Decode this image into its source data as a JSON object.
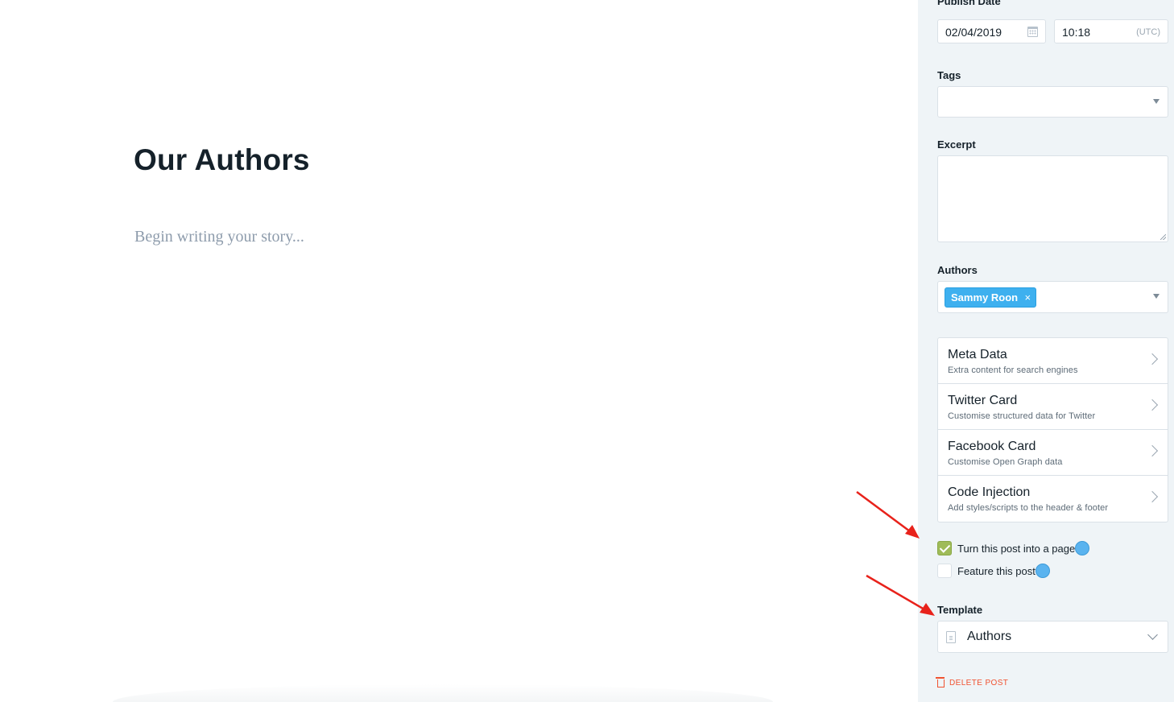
{
  "editor": {
    "title": "Our Authors",
    "story_placeholder": "Begin writing your story..."
  },
  "sidebar": {
    "publish_date_label": "Publish Date",
    "publish_date": "02/04/2019",
    "publish_time": "10:18",
    "timezone": "(UTC)",
    "tags_label": "Tags",
    "excerpt_label": "Excerpt",
    "authors_label": "Authors",
    "authors": [
      "Sammy Roon"
    ],
    "author_remove_glyph": "×",
    "menu": [
      {
        "title": "Meta Data",
        "description": "Extra content for search engines"
      },
      {
        "title": "Twitter Card",
        "description": "Customise structured data for Twitter"
      },
      {
        "title": "Facebook Card",
        "description": "Customise Open Graph data"
      },
      {
        "title": "Code Injection",
        "description": "Add styles/scripts to the header & footer"
      }
    ],
    "page_toggle_label": "Turn this post into a page",
    "page_toggle_checked": true,
    "feature_label": "Feature this post",
    "feature_checked": false,
    "template_label": "Template",
    "template_value": "Authors",
    "delete_label": "DELETE POST"
  },
  "colors": {
    "sidebar_bg": "#eff4f7",
    "accent_blue": "#3eb0ef",
    "checkbox_green": "#9fbb58",
    "delete_red": "#f05230",
    "arrow_red": "#e8221b"
  },
  "icons": [
    "calendar-icon",
    "dropdown-caret-icon",
    "remove-icon",
    "chevron-right-icon",
    "checkmark-icon",
    "help-dot-icon",
    "document-icon",
    "chevron-down-icon",
    "trash-icon"
  ]
}
